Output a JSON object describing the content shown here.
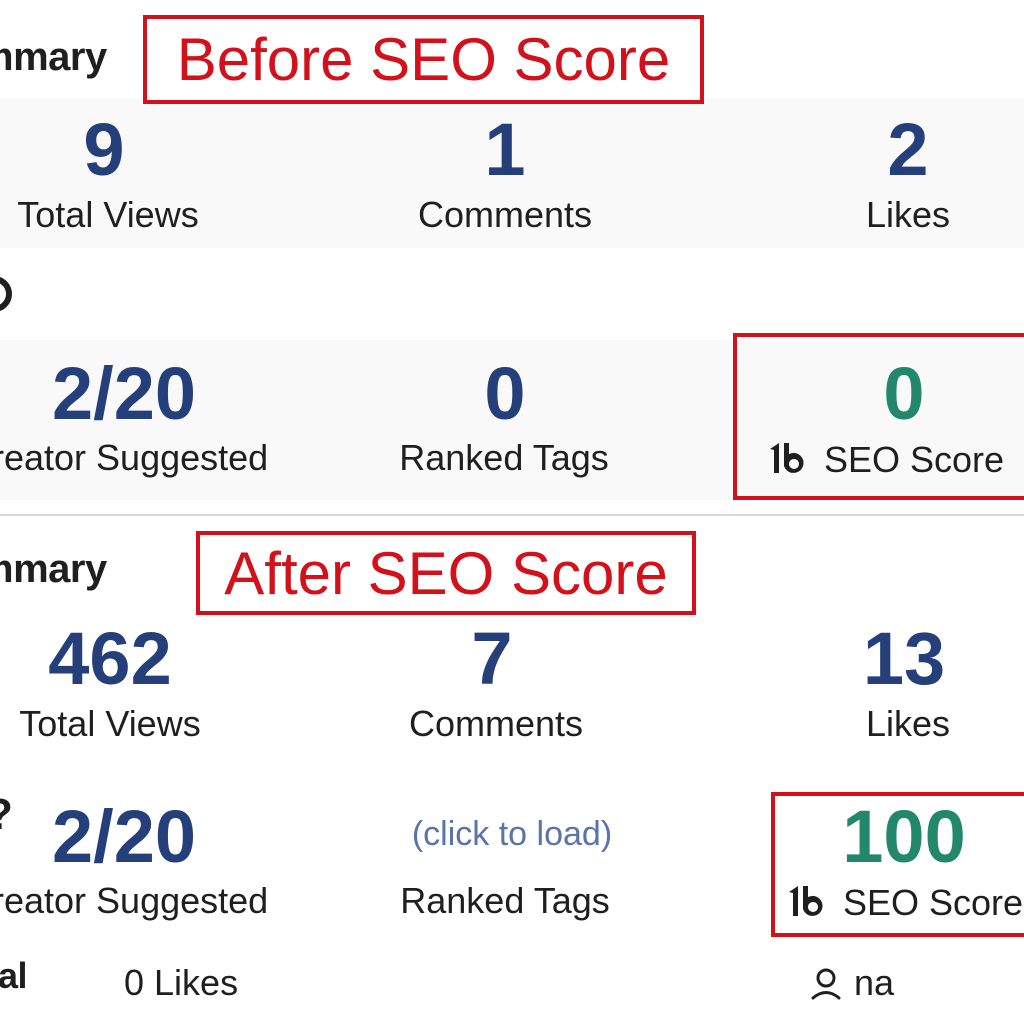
{
  "before": {
    "section_title": "mmary",
    "callout": "Before SEO Score",
    "stats": [
      {
        "value": "9",
        "label": "Total Views"
      },
      {
        "value": "1",
        "label": "Comments"
      },
      {
        "value": "2",
        "label": "Likes"
      }
    ],
    "tags": {
      "suggested_value": "2/20",
      "suggested_label": "reator Suggested",
      "ranked_value": "0",
      "ranked_label": "Ranked Tags",
      "seo_value": "0",
      "seo_label": "SEO Score"
    }
  },
  "after": {
    "section_title": "mmary",
    "callout": "After SEO Score",
    "stats": [
      {
        "value": "462",
        "label": "Total Views"
      },
      {
        "value": "7",
        "label": "Comments"
      },
      {
        "value": "13",
        "label": "Likes"
      }
    ],
    "tags": {
      "suggested_value": "2/20",
      "suggested_label": "reator Suggested",
      "ranked_link": "(click to load)",
      "ranked_label": "Ranked Tags",
      "seo_value": "100",
      "seo_label": "SEO Score"
    }
  },
  "footer": {
    "left_text": "al",
    "likes_text": "0 Likes",
    "user_value": "na"
  },
  "icons": [
    "tubebuddy-logo-icon",
    "user-icon"
  ],
  "colors": {
    "metric_blue": "#253f7a",
    "seo_green": "#23886b",
    "callout_red": "#d2111b",
    "link_blue": "#5a73a8"
  }
}
